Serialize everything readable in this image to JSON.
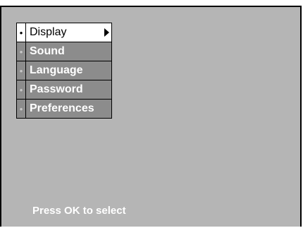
{
  "menu": {
    "items": [
      {
        "bullet": "•",
        "label": "Display",
        "selected": true
      },
      {
        "bullet": "•",
        "label": "Sound",
        "selected": false
      },
      {
        "bullet": "•",
        "label": "Language",
        "selected": false
      },
      {
        "bullet": "•",
        "label": "Password",
        "selected": false
      },
      {
        "bullet": "•",
        "label": "Preferences",
        "selected": false
      }
    ],
    "submenu_indicator": "arrow-right-icon"
  },
  "hint": {
    "text": "Press OK to select"
  },
  "colors": {
    "screen_background": "#b5b5b5",
    "item_background": "#8c8c8c",
    "selected_background": "#ffffff",
    "item_text": "#ffffff",
    "selected_text": "#000000"
  }
}
